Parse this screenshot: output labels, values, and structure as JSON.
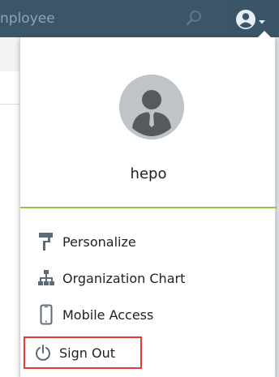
{
  "header": {
    "search_text": "nployee",
    "search_icon": "search-icon",
    "user_icon": "user-circle-icon"
  },
  "dropdown": {
    "username": "hepo",
    "avatar_icon": "person-avatar-icon",
    "divider_color": "#8dc63f",
    "items": [
      {
        "label": "Personalize",
        "icon": "paint-roller-icon"
      },
      {
        "label": "Organization Chart",
        "icon": "org-chart-icon"
      },
      {
        "label": "Mobile Access",
        "icon": "mobile-phone-icon"
      },
      {
        "label": "Sign Out",
        "icon": "power-icon"
      }
    ]
  },
  "colors": {
    "header_bg": "#3b5568",
    "highlight_border": "#e53935"
  }
}
